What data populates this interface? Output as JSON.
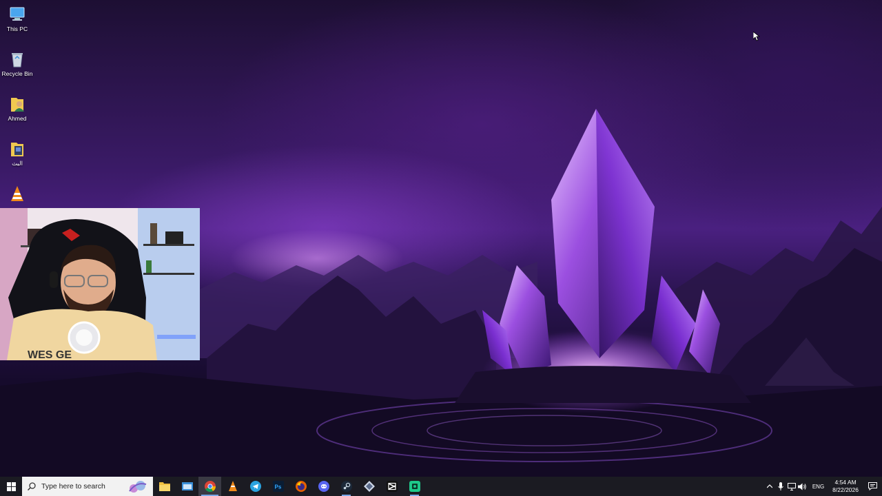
{
  "desktop": {
    "icons": [
      {
        "label": "This PC",
        "icon": "this-pc-icon"
      },
      {
        "label": "Recycle Bin",
        "icon": "recycle-bin-icon"
      },
      {
        "label": "Ahmed",
        "icon": "user-folder-icon"
      },
      {
        "label": "البث",
        "icon": "folder-icon"
      },
      {
        "label": "",
        "icon": "vlc-icon"
      }
    ],
    "wallpaper": "purple-crystal-landscape"
  },
  "webcam": {
    "shirt_text": "WES  GE"
  },
  "taskbar": {
    "search_placeholder": "Type here to search",
    "apps": [
      {
        "name": "file-explorer",
        "icon": "folder-icon"
      },
      {
        "name": "app",
        "icon": "window-icon"
      },
      {
        "name": "chrome",
        "icon": "chrome-icon"
      },
      {
        "name": "vlc",
        "icon": "vlc-icon"
      },
      {
        "name": "telegram",
        "icon": "telegram-icon"
      },
      {
        "name": "photoshop",
        "icon": "photoshop-icon",
        "label": "Ps"
      },
      {
        "name": "firefox",
        "icon": "firefox-icon"
      },
      {
        "name": "discord",
        "icon": "discord-icon"
      },
      {
        "name": "steam",
        "icon": "steam-icon"
      },
      {
        "name": "app-diamond",
        "icon": "diamond-icon"
      },
      {
        "name": "capcut",
        "icon": "capcut-icon"
      },
      {
        "name": "app-green",
        "icon": "green-app-icon"
      }
    ],
    "tray": {
      "language": "ENG",
      "time": "4:54 AM",
      "date": "8/22/2026"
    }
  },
  "colors": {
    "taskbar_bg": "#1b1b22",
    "accent": "#7aa7e8",
    "wallpaper_purple": "#6a2fb0"
  }
}
